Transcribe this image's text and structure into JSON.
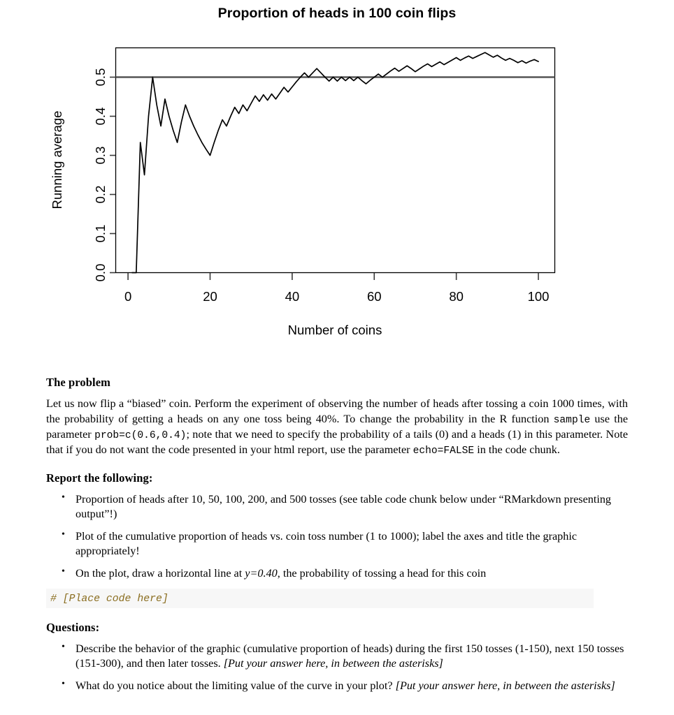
{
  "plot": {
    "title": "Proportion of heads in 100 coin flips",
    "xlabel": "Number of coins",
    "ylabel": "Running average",
    "hline_color": "#555555",
    "line_color": "#000000"
  },
  "chart_data": {
    "type": "line",
    "title": "Proportion of heads in 100 coin flips",
    "xlabel": "Number of coins",
    "ylabel": "Running average",
    "xlim": [
      -3,
      104
    ],
    "ylim": [
      0.0,
      0.575
    ],
    "xticks": [
      0,
      20,
      40,
      60,
      80,
      100
    ],
    "yticks": [
      0.0,
      0.1,
      0.2,
      0.3,
      0.4,
      0.5
    ],
    "grid": false,
    "legend": null,
    "annotations": [
      {
        "type": "hline",
        "y": 0.5,
        "color": "#555555",
        "label": "reference line at 0.5"
      }
    ],
    "x": [
      1,
      2,
      3,
      4,
      5,
      6,
      7,
      8,
      9,
      10,
      11,
      12,
      13,
      14,
      15,
      16,
      17,
      18,
      19,
      20,
      21,
      22,
      23,
      24,
      25,
      26,
      27,
      28,
      29,
      30,
      31,
      32,
      33,
      34,
      35,
      36,
      37,
      38,
      39,
      40,
      41,
      42,
      43,
      44,
      45,
      46,
      47,
      48,
      49,
      50,
      51,
      52,
      53,
      54,
      55,
      56,
      57,
      58,
      59,
      60,
      61,
      62,
      63,
      64,
      65,
      66,
      67,
      68,
      69,
      70,
      71,
      72,
      73,
      74,
      75,
      76,
      77,
      78,
      79,
      80,
      81,
      82,
      83,
      84,
      85,
      86,
      87,
      88,
      89,
      90,
      91,
      92,
      93,
      94,
      95,
      96,
      97,
      98,
      99,
      100
    ],
    "values": [
      0.0,
      0.0,
      0.333,
      0.25,
      0.4,
      0.5,
      0.429,
      0.375,
      0.444,
      0.4,
      0.364,
      0.333,
      0.385,
      0.429,
      0.4,
      0.375,
      0.353,
      0.333,
      0.316,
      0.3,
      0.333,
      0.364,
      0.391,
      0.375,
      0.4,
      0.423,
      0.407,
      0.429,
      0.414,
      0.433,
      0.452,
      0.438,
      0.455,
      0.441,
      0.457,
      0.444,
      0.459,
      0.474,
      0.462,
      0.475,
      0.488,
      0.5,
      0.511,
      0.5,
      0.511,
      0.522,
      0.511,
      0.5,
      0.49,
      0.5,
      0.49,
      0.5,
      0.491,
      0.5,
      0.491,
      0.5,
      0.491,
      0.483,
      0.492,
      0.5,
      0.508,
      0.5,
      0.508,
      0.516,
      0.523,
      0.515,
      0.522,
      0.529,
      0.522,
      0.514,
      0.521,
      0.528,
      0.534,
      0.527,
      0.533,
      0.539,
      0.532,
      0.538,
      0.544,
      0.55,
      0.543,
      0.549,
      0.554,
      0.548,
      0.553,
      0.558,
      0.563,
      0.557,
      0.551,
      0.556,
      0.549,
      0.543,
      0.548,
      0.543,
      0.537,
      0.542,
      0.536,
      0.541,
      0.545,
      0.54
    ],
    "series": [
      {
        "name": "Running average",
        "color": "#000000"
      }
    ]
  },
  "document": {
    "problem_heading": "The problem",
    "problem_paragraph": {
      "part1": "Let us now flip a “biased” coin. Perform the experiment of observing the number of heads after tossing a coin 1000 times, with the probability of getting a heads on any one toss being 40%. To change the probability in the R function ",
      "code1": "sample",
      "part2": " use the parameter ",
      "code2": "prob=c(0.6,0.4)",
      "part3": "; note that we need to specify the probability of a tails (0) and a heads (1) in this parameter. Note that if you do not want the code presented in your html report, use the parameter ",
      "code3": "echo=FALSE",
      "part4": " in the code chunk."
    },
    "report_heading": "Report the following:",
    "report_items": [
      "Proportion of heads after 10, 50, 100, 200, and 500 tosses (see table code chunk below under “RMarkdown presenting output”!)",
      "Plot of the cumulative proportion of heads vs. coin toss number (1 to 1000); label the axes and title the graphic appropriately!"
    ],
    "report_item3": {
      "part1": "On the plot, draw a horizontal line at ",
      "italic": "y=0.40",
      "part2": ", the probability of tossing a head for this coin"
    },
    "code_chunk": "# [Place code here]",
    "questions_heading": "Questions:",
    "question1": {
      "part1": "Describe the behavior of the graphic (cumulative proportion of heads) during the first 150 tosses (1-150), next 150 tosses (151-300), and then later tosses. ",
      "italic": "[Put your answer here, in between the asterisks]"
    },
    "question2": {
      "part1": "What do you notice about the limiting value of the curve in your plot? ",
      "italic": "[Put your answer here, in between the asterisks]"
    }
  }
}
